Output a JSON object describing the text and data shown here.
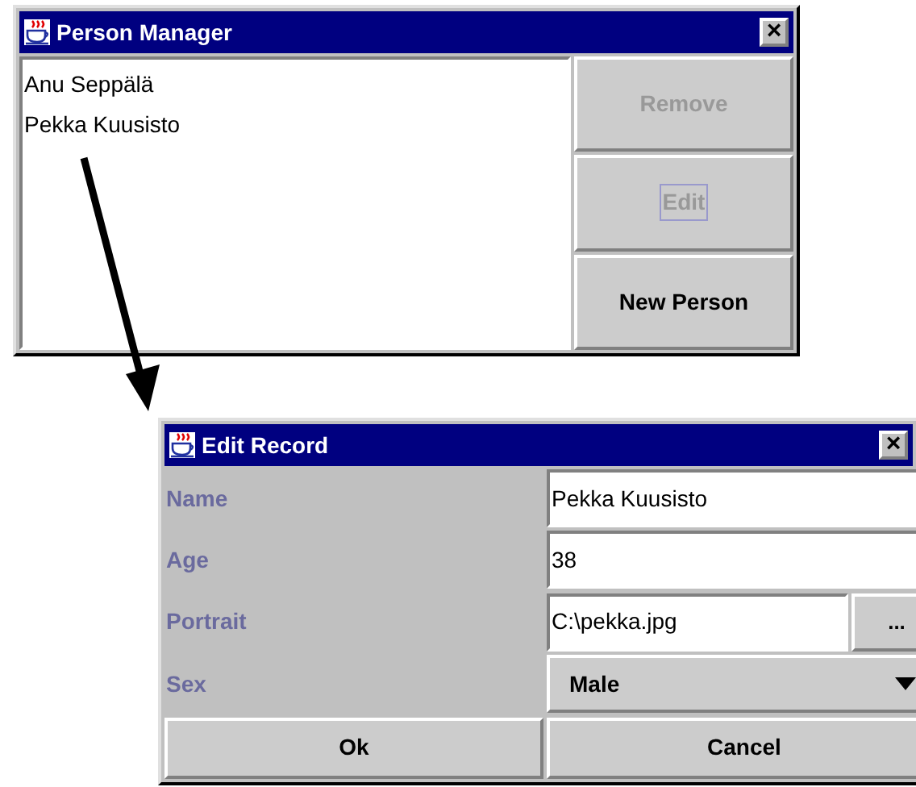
{
  "person_manager": {
    "title": "Person Manager",
    "close": "×",
    "list": [
      {
        "label": "Anu Seppälä",
        "selected": false
      },
      {
        "label": "Pekka Kuusisto",
        "selected": false
      }
    ],
    "buttons": [
      {
        "label": "Remove",
        "disabled": true,
        "focused": false
      },
      {
        "label": "Edit",
        "disabled": true,
        "focused": true
      },
      {
        "label": "New Person",
        "disabled": false,
        "focused": false
      }
    ]
  },
  "edit_record": {
    "title": "Edit Record",
    "close": "×",
    "fields": [
      {
        "kind": "text",
        "label": "Name",
        "value": "Pekka Kuusisto"
      },
      {
        "kind": "text",
        "label": "Age",
        "value": "38"
      },
      {
        "kind": "file",
        "label": "Portrait",
        "value": "C:\\pekka.jpg",
        "button": "..."
      },
      {
        "kind": "select",
        "label": "Sex",
        "value": "Male"
      }
    ],
    "buttons": [
      "Ok",
      "Cancel"
    ]
  }
}
